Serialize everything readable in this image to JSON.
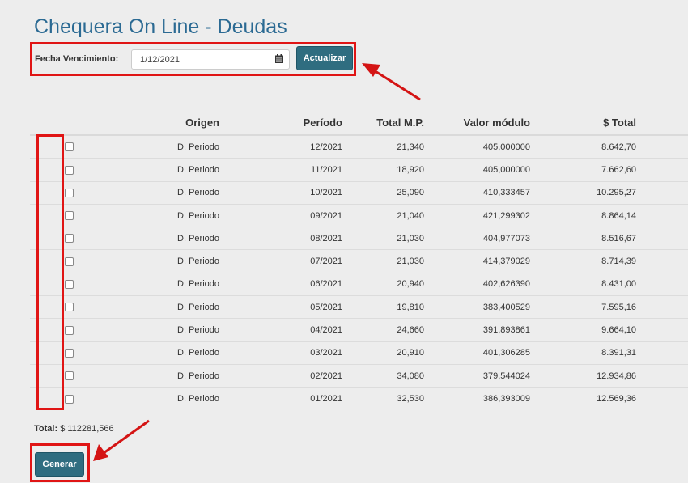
{
  "page": {
    "title": "Chequera On Line - Deudas"
  },
  "filter": {
    "label": "Fecha Vencimiento:",
    "date_value": "1/12/2021",
    "update_label": "Actualizar"
  },
  "table": {
    "headers": {
      "origen": "Origen",
      "periodo": "Período",
      "total_mp": "Total M.P.",
      "valor_modulo": "Valor módulo",
      "total": "$ Total"
    },
    "rows": [
      {
        "origen": "D. Periodo",
        "periodo": "12/2021",
        "total_mp": "21,340",
        "valor_modulo": "405,000000",
        "total": "8.642,70"
      },
      {
        "origen": "D. Periodo",
        "periodo": "11/2021",
        "total_mp": "18,920",
        "valor_modulo": "405,000000",
        "total": "7.662,60"
      },
      {
        "origen": "D. Periodo",
        "periodo": "10/2021",
        "total_mp": "25,090",
        "valor_modulo": "410,333457",
        "total": "10.295,27"
      },
      {
        "origen": "D. Periodo",
        "periodo": "09/2021",
        "total_mp": "21,040",
        "valor_modulo": "421,299302",
        "total": "8.864,14"
      },
      {
        "origen": "D. Periodo",
        "periodo": "08/2021",
        "total_mp": "21,030",
        "valor_modulo": "404,977073",
        "total": "8.516,67"
      },
      {
        "origen": "D. Periodo",
        "periodo": "07/2021",
        "total_mp": "21,030",
        "valor_modulo": "414,379029",
        "total": "8.714,39"
      },
      {
        "origen": "D. Periodo",
        "periodo": "06/2021",
        "total_mp": "20,940",
        "valor_modulo": "402,626390",
        "total": "8.431,00"
      },
      {
        "origen": "D. Periodo",
        "periodo": "05/2021",
        "total_mp": "19,810",
        "valor_modulo": "383,400529",
        "total": "7.595,16"
      },
      {
        "origen": "D. Periodo",
        "periodo": "04/2021",
        "total_mp": "24,660",
        "valor_modulo": "391,893861",
        "total": "9.664,10"
      },
      {
        "origen": "D. Periodo",
        "periodo": "03/2021",
        "total_mp": "20,910",
        "valor_modulo": "401,306285",
        "total": "8.391,31"
      },
      {
        "origen": "D. Periodo",
        "periodo": "02/2021",
        "total_mp": "34,080",
        "valor_modulo": "379,544024",
        "total": "12.934,86"
      },
      {
        "origen": "D. Periodo",
        "periodo": "01/2021",
        "total_mp": "32,530",
        "valor_modulo": "386,393009",
        "total": "12.569,36"
      }
    ]
  },
  "summary": {
    "total_label": "Total:",
    "total_value": "$ 112281,566"
  },
  "actions": {
    "generate_label": "Generar"
  },
  "colors": {
    "title": "#2b6a93",
    "button": "#2f6d80",
    "highlight": "#e01515",
    "background": "#ededed"
  },
  "icons": {
    "date": "calendar-icon"
  }
}
